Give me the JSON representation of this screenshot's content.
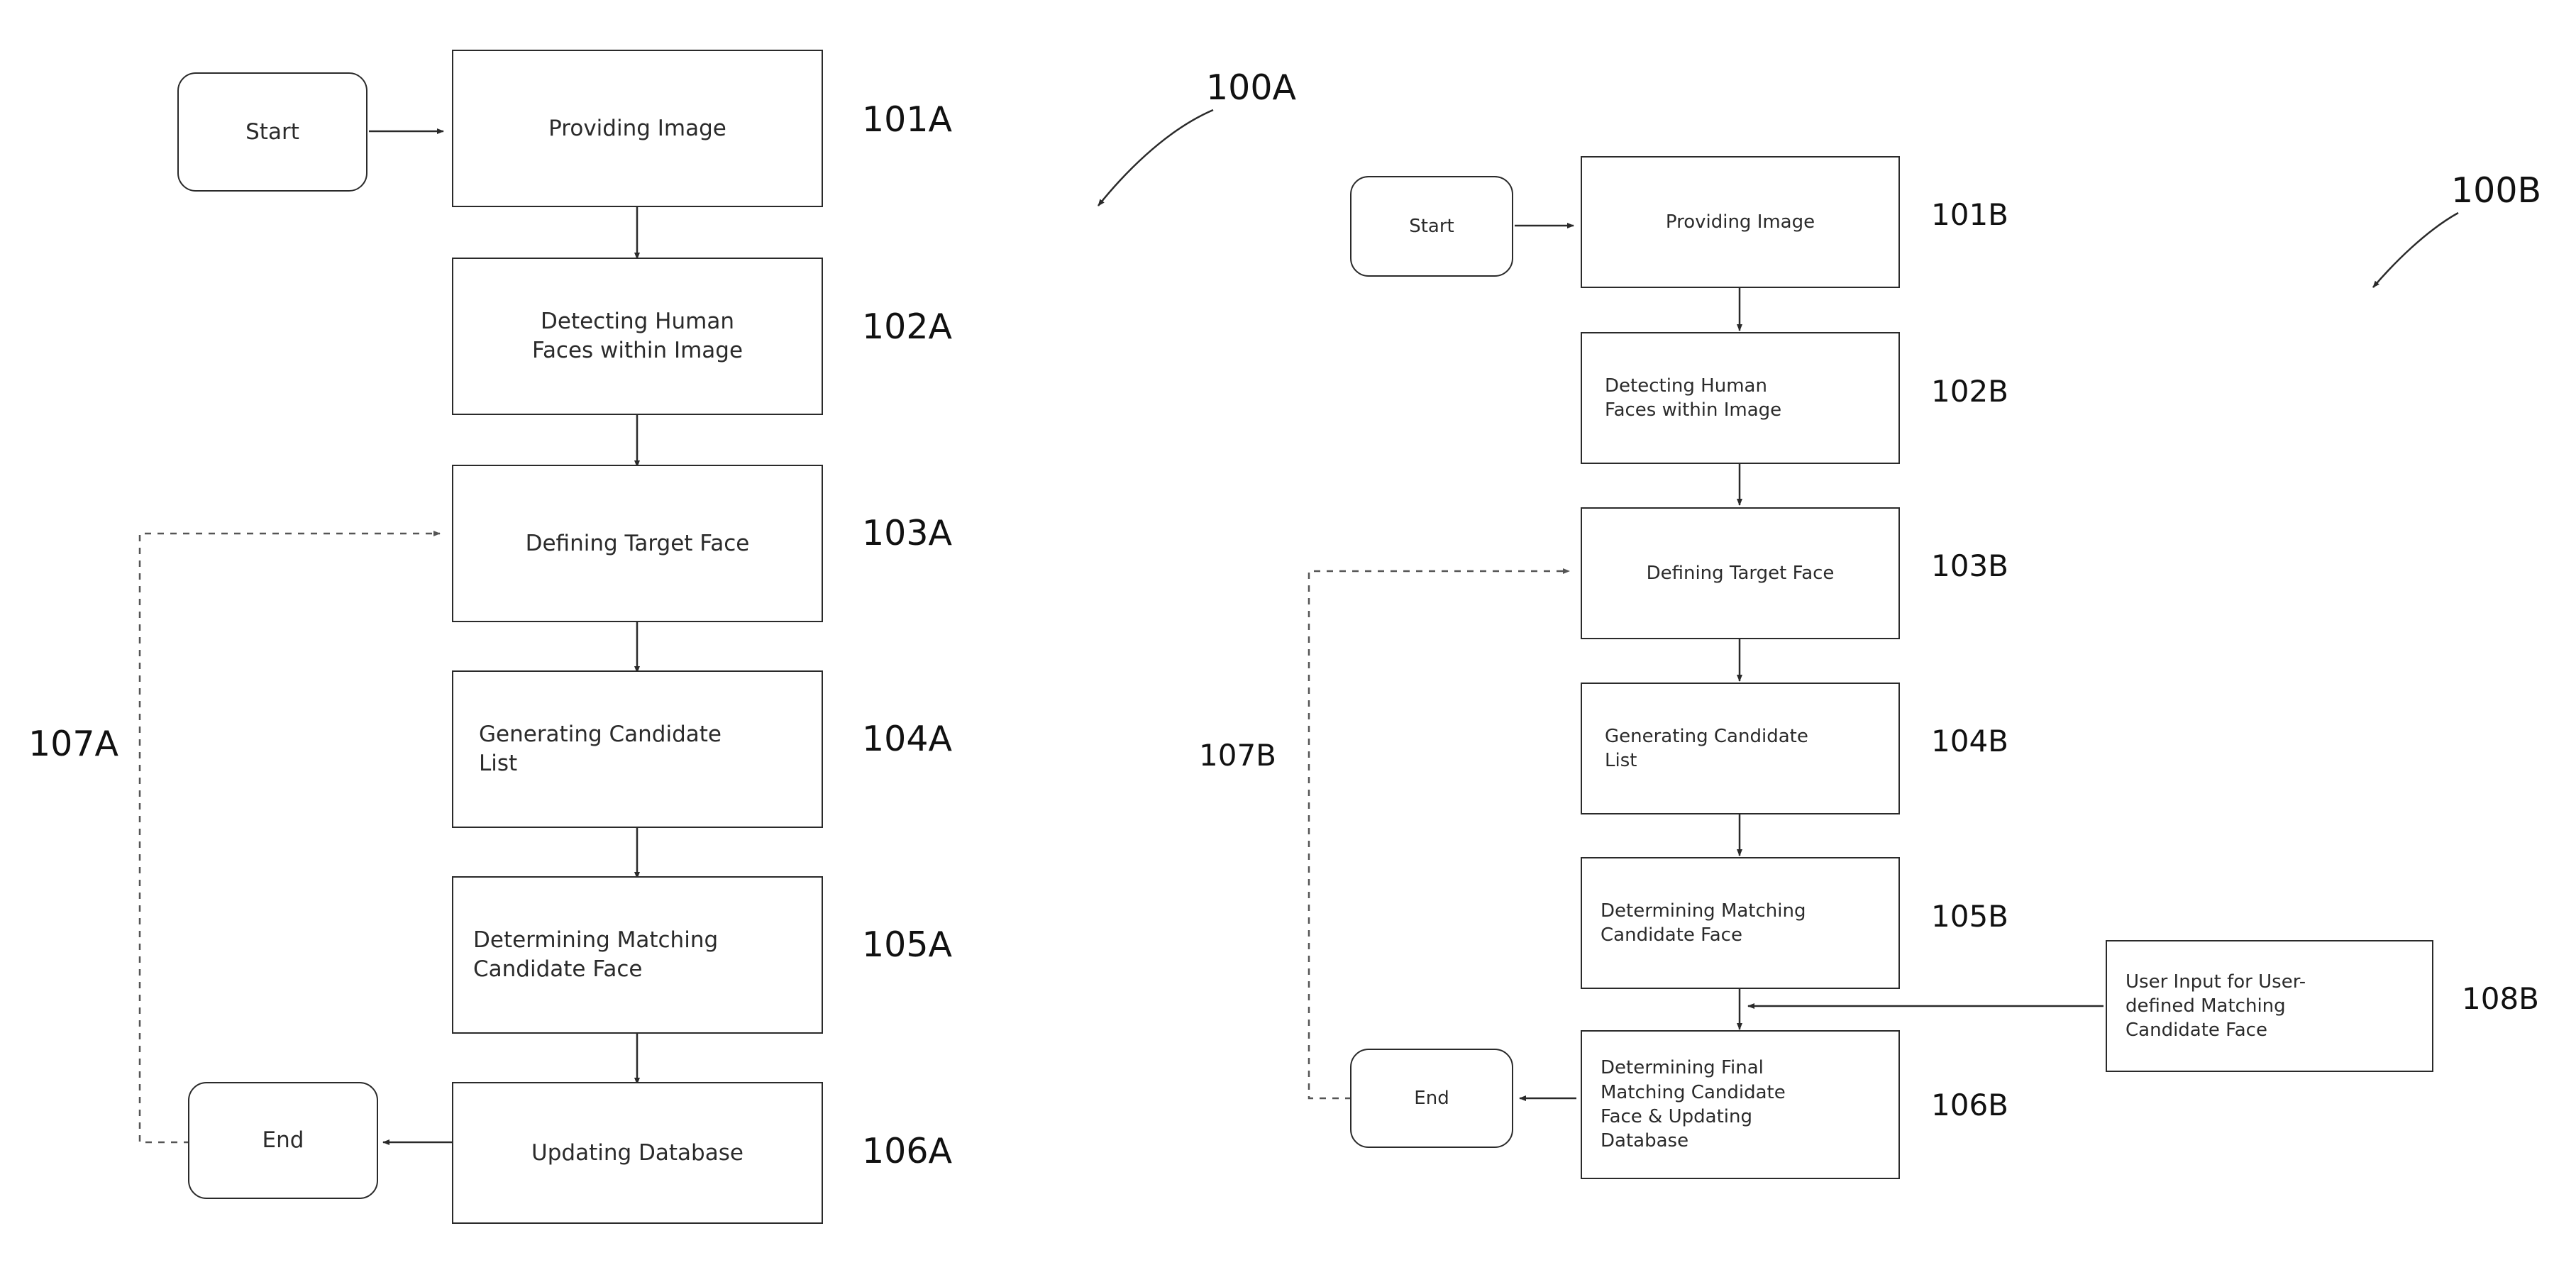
{
  "figure": {
    "flow_a": {
      "label": "100A",
      "nodes": [
        {
          "id": "start-a",
          "text": "Start",
          "ref": ""
        },
        {
          "id": "step-101a",
          "text": "Providing Image",
          "ref": "101A"
        },
        {
          "id": "step-102a",
          "text": "Detecting Human\nFaces within Image",
          "ref": "102A"
        },
        {
          "id": "step-103a",
          "text": "Defining Target Face",
          "ref": "103A"
        },
        {
          "id": "step-104a",
          "text": "Generating Candidate\nList",
          "ref": "104A"
        },
        {
          "id": "step-105a",
          "text": "Determining Matching\nCandidate Face",
          "ref": "105A"
        },
        {
          "id": "step-106a",
          "text": "Updating Database",
          "ref": "106A"
        },
        {
          "id": "end-a",
          "text": "End",
          "ref": ""
        }
      ],
      "feedback_ref": "107A"
    },
    "flow_b": {
      "label": "100B",
      "nodes": [
        {
          "id": "start-b",
          "text": "Start",
          "ref": ""
        },
        {
          "id": "step-101b",
          "text": "Providing Image",
          "ref": "101B"
        },
        {
          "id": "step-102b",
          "text": "Detecting Human\nFaces within Image",
          "ref": "102B"
        },
        {
          "id": "step-103b",
          "text": "Defining Target Face",
          "ref": "103B"
        },
        {
          "id": "step-104b",
          "text": "Generating Candidate\nList",
          "ref": "104B"
        },
        {
          "id": "step-105b",
          "text": "Determining Matching\nCandidate Face",
          "ref": "105B"
        },
        {
          "id": "step-106b",
          "text": "Determining Final\nMatching Candidate\nFace & Updating\nDatabase",
          "ref": "106B"
        },
        {
          "id": "step-108b",
          "text": "User Input for User-\ndefined Matching\nCandidate Face",
          "ref": "108B"
        },
        {
          "id": "end-b",
          "text": "End",
          "ref": ""
        }
      ],
      "feedback_ref": "107B"
    },
    "colors": {
      "stroke": "#2a2a2a",
      "text": "#2b2b2b",
      "background": "#ffffff",
      "dashed": "#555555"
    }
  }
}
